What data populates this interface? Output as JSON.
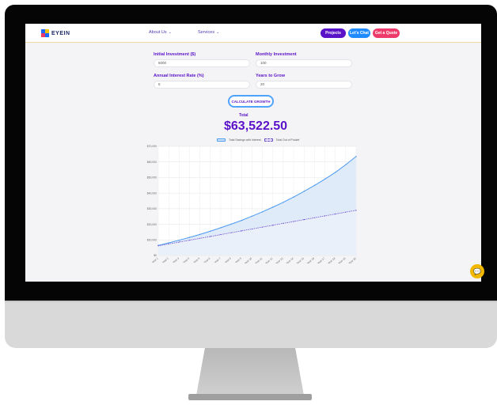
{
  "header": {
    "logo_text": "EYEIN",
    "nav": [
      {
        "label": "About Us",
        "chevron": "⌄"
      },
      {
        "label": "Services",
        "chevron": "⌄"
      }
    ],
    "buttons": {
      "projects": "Projects",
      "chat": "Let's Chat",
      "quote": "Get a Quote"
    }
  },
  "form": {
    "initial_label": "Initial Investment ($)",
    "initial_value": "5000",
    "monthly_label": "Monthly Investment",
    "monthly_value": "100",
    "rate_label": "Annual Interest Rate (%)",
    "rate_value": "5",
    "years_label": "Years to Grow",
    "years_value": "20",
    "calc_button": "CALCULATE GROWTH"
  },
  "result": {
    "total_label": "Total",
    "total_value": "$63,522.50"
  },
  "colors": {
    "accent": "#5a12c9",
    "blue": "#1f8bff",
    "pink": "#ee3a6a",
    "line_total": "#4b9af0",
    "line_pocket": "#6a4ccf"
  },
  "chart_data": {
    "type": "line",
    "title": "",
    "xlabel": "",
    "ylabel": "",
    "ylim": [
      0,
      70000
    ],
    "yticks": [
      "$0",
      "$10,000",
      "$20,000",
      "$30,000",
      "$40,000",
      "$50,000",
      "$60,000",
      "$70,000"
    ],
    "grid": true,
    "legend": "top",
    "categories": [
      "Year 1",
      "Year 2",
      "Year 3",
      "Year 4",
      "Year 5",
      "Year 6",
      "Year 7",
      "Year 8",
      "Year 9",
      "Year 10",
      "Year 11",
      "Year 12",
      "Year 13",
      "Year 14",
      "Year 15",
      "Year 16",
      "Year 17",
      "Year 18",
      "Year 19",
      "Year 20"
    ],
    "series": [
      {
        "name": "Total Savings with Interest",
        "values": [
          6500,
          8100,
          9800,
          11600,
          13500,
          15600,
          17800,
          20100,
          22500,
          25200,
          28000,
          31000,
          34100,
          37500,
          41100,
          44900,
          49000,
          53300,
          58200,
          63522.5
        ]
      },
      {
        "name": "Total Out of Pocket",
        "values": [
          6200,
          7400,
          8600,
          9800,
          11000,
          12200,
          13400,
          14600,
          15800,
          17000,
          18200,
          19400,
          20600,
          21800,
          23000,
          24200,
          25400,
          26600,
          27800,
          29000
        ]
      }
    ]
  }
}
